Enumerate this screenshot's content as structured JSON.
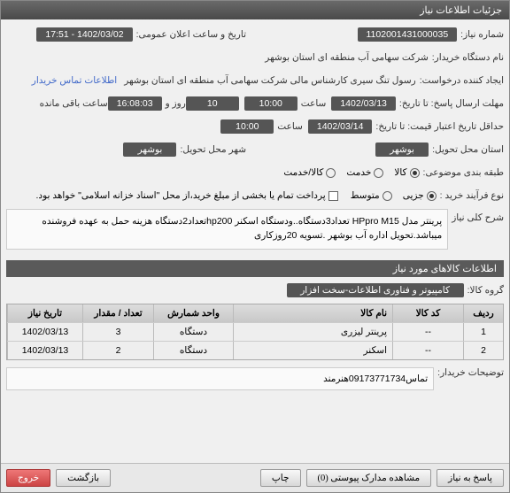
{
  "header": {
    "title": "جزئیات اطلاعات نیاز"
  },
  "fields": {
    "need_number_label": "شماره نیاز:",
    "need_number": "1102001431000035",
    "announce_label": "تاریخ و ساعت اعلان عمومی:",
    "announce_value": "1402/03/02 - 17:51",
    "buyer_label": "نام دستگاه خریدار:",
    "buyer_value": "شرکت سهامی آب منطقه ای استان بوشهر",
    "requester_label": "ایجاد کننده درخواست:",
    "requester_value": "رسول تنگ سیری کارشناس مالی شرکت سهامی آب منطقه ای استان بوشهر",
    "contact_link": "اطلاعات تماس خریدار",
    "deadline_send_label": "مهلت ارسال پاسخ: تا تاریخ:",
    "deadline_send_date": "1402/03/13",
    "deadline_send_time_label": "ساعت",
    "deadline_send_time": "10:00",
    "duration": "10",
    "duration_label": "روز و",
    "remaining_time": "16:08:03",
    "remaining_label": "ساعت باقی مانده",
    "validity_label": "حداقل تاریخ اعتبار قیمت: تا تاریخ:",
    "validity_date": "1402/03/14",
    "validity_time_label": "ساعت",
    "validity_time": "10:00",
    "exec_province_label": "استان محل تحویل:",
    "exec_province": "بوشهر",
    "exec_city_label": "شهر محل تحویل:",
    "exec_city": "بوشهر",
    "category_label": "طبقه بندی موضوعی:",
    "cat_goods": "کالا",
    "cat_service": "خدمت",
    "cat_goods_service": "کالا/خدمت",
    "process_label": "نوع فرآیند خرید :",
    "proc_partial": "جزیی",
    "proc_medium": "متوسط",
    "payment_note": "پرداخت تمام یا بخشی از مبلغ خرید،از محل \"اسناد خزانه اسلامی\" خواهد بود.",
    "desc_label": "شرح کلی نیاز",
    "desc_text": "پرینتر مدل HPpro M15 تعداد3دستگاه..ودستگاه اسکنر hp200تعداد2دستگاه هزینه حمل به عهده فروشنده میباشد.تحویل اداره آب بوشهر .تسویه 20روزکاری"
  },
  "items_section": {
    "title": "اطلاعات کالاهای مورد نیاز",
    "group_label": "گروه کالا:",
    "group_value": "کامپیوتر و فناوری اطلاعات-سخت افزار",
    "headers": {
      "row": "ردیف",
      "code": "کد کالا",
      "name": "نام کالا",
      "unit": "واحد شمارش",
      "qty": "تعداد / مقدار",
      "date": "تاریخ نیاز"
    },
    "rows": [
      {
        "row": "1",
        "code": "--",
        "name": "پرینتر لیزری",
        "unit": "دستگاه",
        "qty": "3",
        "date": "1402/03/13"
      },
      {
        "row": "2",
        "code": "--",
        "name": "اسکنر",
        "unit": "دستگاه",
        "qty": "2",
        "date": "1402/03/13"
      }
    ]
  },
  "notes": {
    "buyer_note_label": "توضیحات خریدار:",
    "buyer_note": "تماس09173771734هنرمند"
  },
  "footer": {
    "reply": "پاسخ به نیاز",
    "attachments": "مشاهده مدارک پیوستی (0)",
    "print": "چاپ",
    "back": "بازگشت",
    "exit": "خروج"
  }
}
